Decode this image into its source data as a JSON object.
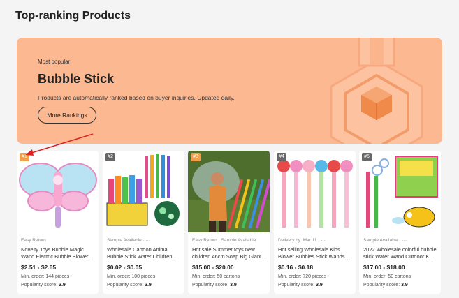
{
  "header": {
    "title": "Top-ranking Products"
  },
  "hero": {
    "label": "Most popular",
    "name": "Bubble Stick",
    "description": "Products are automatically ranked based on buyer inquiries. Updated daily.",
    "button": "More Rankings"
  },
  "products": [
    {
      "rank": "#1",
      "tag": "Easy Return",
      "title": "Novelty Toys Bubble Magic Wand Electric Bubble Blower...",
      "price": "$2.51 - $2.65",
      "moq": "Min. order: 144 pieces",
      "score_label": "Popularity score:",
      "score": "3.9"
    },
    {
      "rank": "#2",
      "tag": "Sample Available · ···",
      "title": "Wholesale Cartoon Animal Bubble Stick Water Children...",
      "price": "$0.02 - $0.05",
      "moq": "Min. order: 100 pieces",
      "score_label": "Popularity score:",
      "score": "3.9"
    },
    {
      "rank": "#3",
      "tag": "Easy Return · Sample Available",
      "title": "Hot sale Summer toys new children 46cm Soap Big Giant...",
      "price": "$15.00 - $20.00",
      "moq": "Min. order: 50 cartons",
      "score_label": "Popularity score:",
      "score": "3.9"
    },
    {
      "rank": "#4",
      "tag": "Delivery by: Mar 11 · ···",
      "title": "Hot selling Wholesale Kids Blower Bubbles Stick Wands...",
      "price": "$0.16 - $0.18",
      "moq": "Min. order: 720 pieces",
      "score_label": "Popularity score:",
      "score": "3.9"
    },
    {
      "rank": "#5",
      "tag": "Sample Available · ···",
      "title": "2022 Wholesale colorful bubble stick Water Wand Outdoor Ki...",
      "price": "$17.00 - $18.00",
      "moq": "Min. order: 50 cartons",
      "score_label": "Popularity score:",
      "score": "3.9"
    }
  ],
  "colors": {
    "hero_bg": "#fcb891",
    "rank_top": "#f0a04b",
    "rank_other": "#666666",
    "arrow": "#e02020"
  }
}
